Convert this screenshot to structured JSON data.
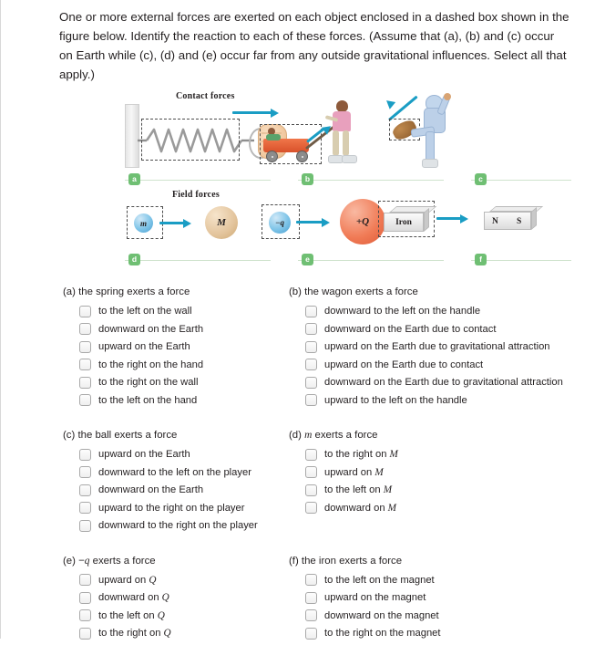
{
  "question": {
    "stem": "One or more external forces are exerted on each object enclosed in a dashed box shown in the figure below. Identify the reaction to each of these forces. (Assume that (a), (b) and (c) occur on Earth while (c), (d) and (e) occur far from any outside gravitational influences. Select all that apply.)"
  },
  "figure": {
    "contact_label": "Contact forces",
    "field_label": "Field forces",
    "badges": [
      "a",
      "b",
      "c",
      "d",
      "e",
      "f"
    ],
    "labels": {
      "m": "m",
      "M": "M",
      "minus_q": "−q",
      "plus_Q": "+Q",
      "iron": "Iron",
      "magnet_n": "N",
      "magnet_s": "S"
    },
    "colors": {
      "arrow": "#1a9dc4",
      "badge": "#6fbf73",
      "rule": "#cfe3cd",
      "wagon": "#e0582f",
      "charge_positive": "#f07a55",
      "charge_negative": "#7ec4e8",
      "mass_small": "#7ec4e8",
      "mass_large": "#e3c49c"
    }
  },
  "parts": [
    {
      "id": "a",
      "title": "(a) the spring exerts a force",
      "options": [
        "to the left on the wall",
        "downward on the Earth",
        "upward on the Earth",
        "to the right on the hand",
        "to the right on the wall",
        "to the left on the hand"
      ]
    },
    {
      "id": "b",
      "title": "(b) the wagon exerts a force",
      "options": [
        "downward to the left on the handle",
        "downward on the Earth due to contact",
        "upward on the Earth due to gravitational attraction",
        "upward on the Earth due to contact",
        "downward on the Earth due to gravitational attraction",
        "upward to the left on the handle"
      ]
    },
    {
      "id": "c",
      "title": "(c) the ball exerts a force",
      "options": [
        "upward on the Earth",
        "downward to the left on the player",
        "downward on the Earth",
        "upward to the right on the player",
        "downward to the right on the player"
      ]
    },
    {
      "id": "d",
      "title_prefix": "(d) ",
      "title_sym": "m",
      "title_suffix": " exerts a force",
      "options_parts": [
        {
          "pre": "to the right on ",
          "sym": "M",
          "post": ""
        },
        {
          "pre": "upward on ",
          "sym": "M",
          "post": ""
        },
        {
          "pre": "to the left on ",
          "sym": "M",
          "post": ""
        },
        {
          "pre": "downward on ",
          "sym": "M",
          "post": ""
        }
      ]
    },
    {
      "id": "e",
      "title_prefix": "(e) −",
      "title_sym": "q",
      "title_suffix": " exerts a force",
      "options_parts": [
        {
          "pre": "upward on ",
          "sym": "Q",
          "post": ""
        },
        {
          "pre": "downward on ",
          "sym": "Q",
          "post": ""
        },
        {
          "pre": "to the left on ",
          "sym": "Q",
          "post": ""
        },
        {
          "pre": "to the right on ",
          "sym": "Q",
          "post": ""
        }
      ]
    },
    {
      "id": "f",
      "title": "(f) the iron exerts a force",
      "options": [
        "to the left on the magnet",
        "upward on the magnet",
        "downward on the magnet",
        "to the right on the magnet"
      ]
    }
  ]
}
